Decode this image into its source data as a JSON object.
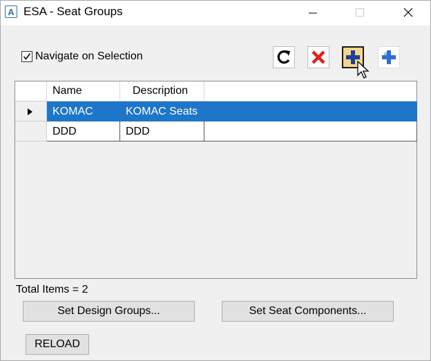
{
  "window": {
    "title": "ESA - Seat Groups",
    "app_icon_letter": "A"
  },
  "navigate_on_selection": {
    "label": "Navigate on Selection",
    "checked": true
  },
  "toolbar": {
    "buttons": [
      {
        "name": "refresh",
        "icon": "refresh-icon"
      },
      {
        "name": "delete",
        "icon": "delete-x-icon",
        "color": "#e02020"
      },
      {
        "name": "add",
        "icon": "plus-icon",
        "color": "#1e3f9a",
        "state": "hovered"
      },
      {
        "name": "add-sub",
        "icon": "plus-icon",
        "color": "#2f6fd1"
      }
    ]
  },
  "grid": {
    "columns": [
      "Name",
      "Description"
    ],
    "rows": [
      {
        "name": "KOMAC",
        "description": "KOMAC Seats",
        "selected": true
      },
      {
        "name": "DDD",
        "description": "DDD",
        "selected": false
      }
    ]
  },
  "status": {
    "total_items": "Total Items = 2"
  },
  "buttons": {
    "set_design_groups": "Set Design Groups...",
    "set_seat_components": "Set Seat Components...",
    "reload": "RELOAD"
  },
  "colors": {
    "selection": "#1e76c8",
    "add_highlight": "#f5d689"
  }
}
